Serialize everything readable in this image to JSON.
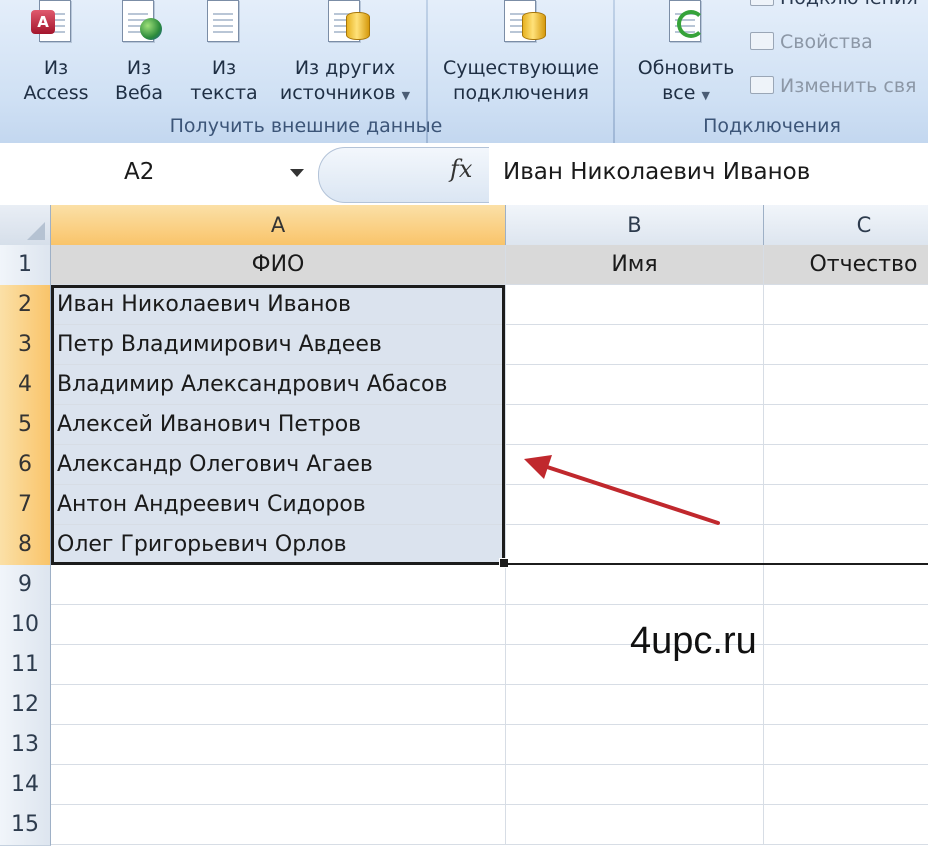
{
  "ribbon": {
    "buttons": [
      {
        "line1": "Из",
        "line2": "Access"
      },
      {
        "line1": "Из",
        "line2": "Веба"
      },
      {
        "line1": "Из",
        "line2": "текста"
      },
      {
        "line1": "Из других",
        "line2": "источников"
      },
      {
        "line1": "Существующие",
        "line2": "подключения"
      },
      {
        "line1": "Обновить",
        "line2": "все"
      }
    ],
    "group1_label": "Получить внешние данные",
    "group2_label": "Подключения",
    "small": {
      "connections": "Подключения",
      "properties": "Свойства",
      "edit_links": "Изменить свя"
    }
  },
  "formula_bar": {
    "name_box": "A2",
    "fx": "fx",
    "formula": "Иван Николаевич Иванов"
  },
  "columns": [
    "A",
    "B",
    "C"
  ],
  "rows": [
    "1",
    "2",
    "3",
    "4",
    "5",
    "6",
    "7",
    "8",
    "9",
    "10",
    "11",
    "12",
    "13",
    "14",
    "15"
  ],
  "header_row": {
    "a": "ФИО",
    "b": "Имя",
    "c": "Отчество"
  },
  "names": [
    "Иван Николаевич Иванов",
    "Петр Владимирович Авдеев",
    "Владимир Александрович Абасов",
    "Алексей Иванович Петров",
    "Александр Олегович Агаев",
    "Антон Андреевич Сидоров",
    "Олег Григорьевич Орлов"
  ],
  "watermark": "4upc.ru",
  "colors": {
    "selection_header": "#f9c46a",
    "selection_fill": "#dbe3ee",
    "arrow": "#c0282d"
  }
}
